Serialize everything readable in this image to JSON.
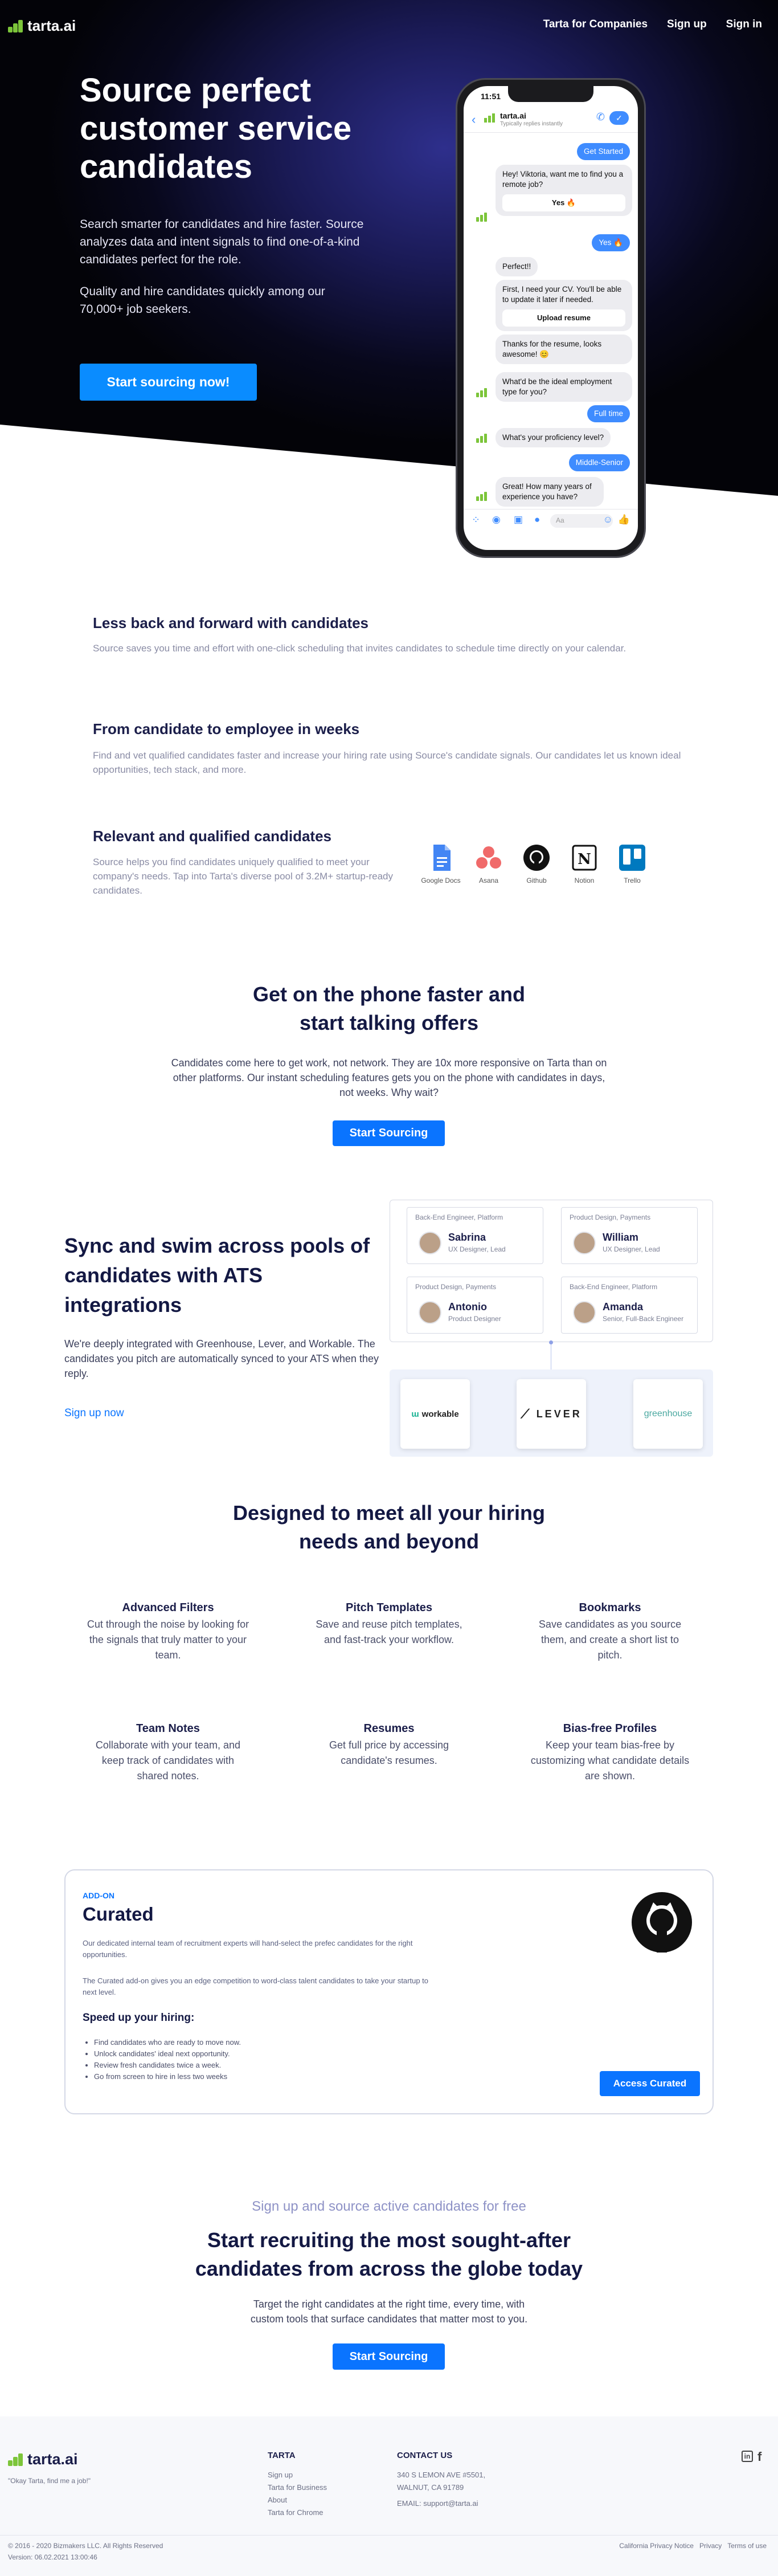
{
  "brand": {
    "name": "tarta.ai"
  },
  "nav": [
    "Tarta for Companies",
    "Sign up",
    "Sign in"
  ],
  "hero": {
    "title": "Source perfect customer service candidates",
    "p1": "Search smarter for candidates and hire faster. Source analyzes data and intent signals to find one-of-a-kind candidates perfect for the role.",
    "p2": "Quality and hire candidates quickly among our 70,000+ job seekers.",
    "cta": "Start sourcing now!"
  },
  "phone": {
    "time": "11:51",
    "contact": "tarta.ai",
    "status": "Typically replies instantly",
    "composer_placeholder": "Aa",
    "messages": {
      "m1": "Get Started",
      "m2": "Hey! Viktoria, want me to find you a remote job?",
      "m2_btn": "Yes 🔥",
      "m3": "Yes 🔥",
      "m4": "Perfect!!",
      "m5": "First, I need your CV. You'll be able to update it later if needed.",
      "m5_btn": "Upload resume",
      "m6": "Thanks for the resume, looks awesome! 😊",
      "m7": "What'd be the ideal employment type for you?",
      "m8": "Full time",
      "m9": "What's your proficiency level?",
      "m10": "Middle-Senior",
      "m11": "Great! How many years of experience you have?"
    }
  },
  "features": [
    {
      "title": "Less back and forward with candidates",
      "text": "Source saves you time and effort with one-click scheduling that invites candidates to schedule time directly on your calendar."
    },
    {
      "title": "From candidate to employee in weeks",
      "text": "Find and vet qualified candidates faster and increase your hiring rate using Source's candidate signals. Our candidates let us known ideal opportunities, tech stack, and more."
    },
    {
      "title": "Relevant and qualified candidates",
      "text": "Source helps you find candidates uniquely qualified to meet your company's needs. Tap into Tarta's diverse pool of 3.2M+ startup-ready candidates."
    }
  ],
  "tools": [
    "Google Docs",
    "Asana",
    "Github",
    "Notion",
    "Trello"
  ],
  "phone_section": {
    "title_l1": "Get on the phone faster and",
    "title_l2": "start talking offers",
    "text": "Candidates come here to get work, not network. They are 10x more responsive on Tarta than on other platforms. Our instant scheduling features gets you on the phone with candidates in days, not weeks. Why wait?",
    "cta": "Start Sourcing"
  },
  "sync": {
    "title": "Sync and swim across pools of candidates with ATS integrations",
    "text": "We're deeply integrated with Greenhouse, Lever, and Workable. The candidates you pitch are automatically synced to your ATS when they reply.",
    "link": "Sign up now",
    "cards": [
      {
        "header": "Back-End Engineer, Platform",
        "name": "Sabrina",
        "role": "UX Designer, Lead"
      },
      {
        "header": "Product Design, Payments",
        "name": "William",
        "role": "UX Designer, Lead"
      },
      {
        "header": "Product Design, Payments",
        "name": "Antonio",
        "role": "Product Designer"
      },
      {
        "header": "Back-End Engineer, Platform",
        "name": "Amanda",
        "role": "Senior, Full-Back Engineer"
      }
    ],
    "ats": [
      "workable",
      "LEVER",
      "greenhouse"
    ]
  },
  "designed": {
    "title_l1": "Designed to meet all your hiring",
    "title_l2": "needs and beyond",
    "items": [
      {
        "title": "Advanced Filters",
        "text": "Cut through the noise by looking for the signals that truly matter to your team."
      },
      {
        "title": "Pitch Templates",
        "text": "Save and reuse pitch templates, and fast-track your workflow."
      },
      {
        "title": "Bookmarks",
        "text": "Save candidates as you source them, and create a short list to pitch."
      },
      {
        "title": "Team Notes",
        "text": "Collaborate with your team, and keep track of candidates with shared notes."
      },
      {
        "title": "Resumes",
        "text": "Get full price by accessing candidate's resumes."
      },
      {
        "title": "Bias-free Profiles",
        "text": "Keep your team bias-free by customizing what candidate details are shown."
      }
    ]
  },
  "curated": {
    "addon": "ADD-ON",
    "title": "Curated",
    "p1": "Our dedicated internal team of recruitment experts will hand-select the prefec candidates for the right opportunities.",
    "p2": "The Curated add-on gives you an edge competition to word-class talent candidates to take your startup to next level.",
    "speed": "Speed up your hiring:",
    "list": [
      "Find candidates who are ready to move now.",
      "Unlock candidates' ideal next opportunity.",
      "Review fresh candidates twice a week.",
      "Go from screen to hire in less two weeks"
    ],
    "cta": "Access Curated"
  },
  "final": {
    "sub": "Sign up and source active candidates for free",
    "title_l1": "Start recruiting the most sought-after",
    "title_l2": "candidates from across the globe today",
    "text": "Target the right candidates at the right time, every time, with custom tools that surface candidates that matter most to you.",
    "cta": "Start Sourcing"
  },
  "footer": {
    "tagline": "\"Okay Tarta, find me a job!\"",
    "tarta_head": "TARTA",
    "tarta_links": [
      "Sign up",
      "Tarta for Business",
      "About",
      "Tarta for Chrome"
    ],
    "contact_head": "CONTACT US",
    "address_l1": "340 S LEMON AVE #5501,",
    "address_l2": "WALNUT, CA 91789",
    "email": "EMAIL: support@tarta.ai",
    "copyright": "© 2016 - 2020 Bizmakers LLC. All Rights Reserved",
    "version": "Version: 06.02.2021 13:00:46",
    "legal": [
      "California Privacy Notice",
      "Privacy",
      "Terms of use"
    ]
  }
}
